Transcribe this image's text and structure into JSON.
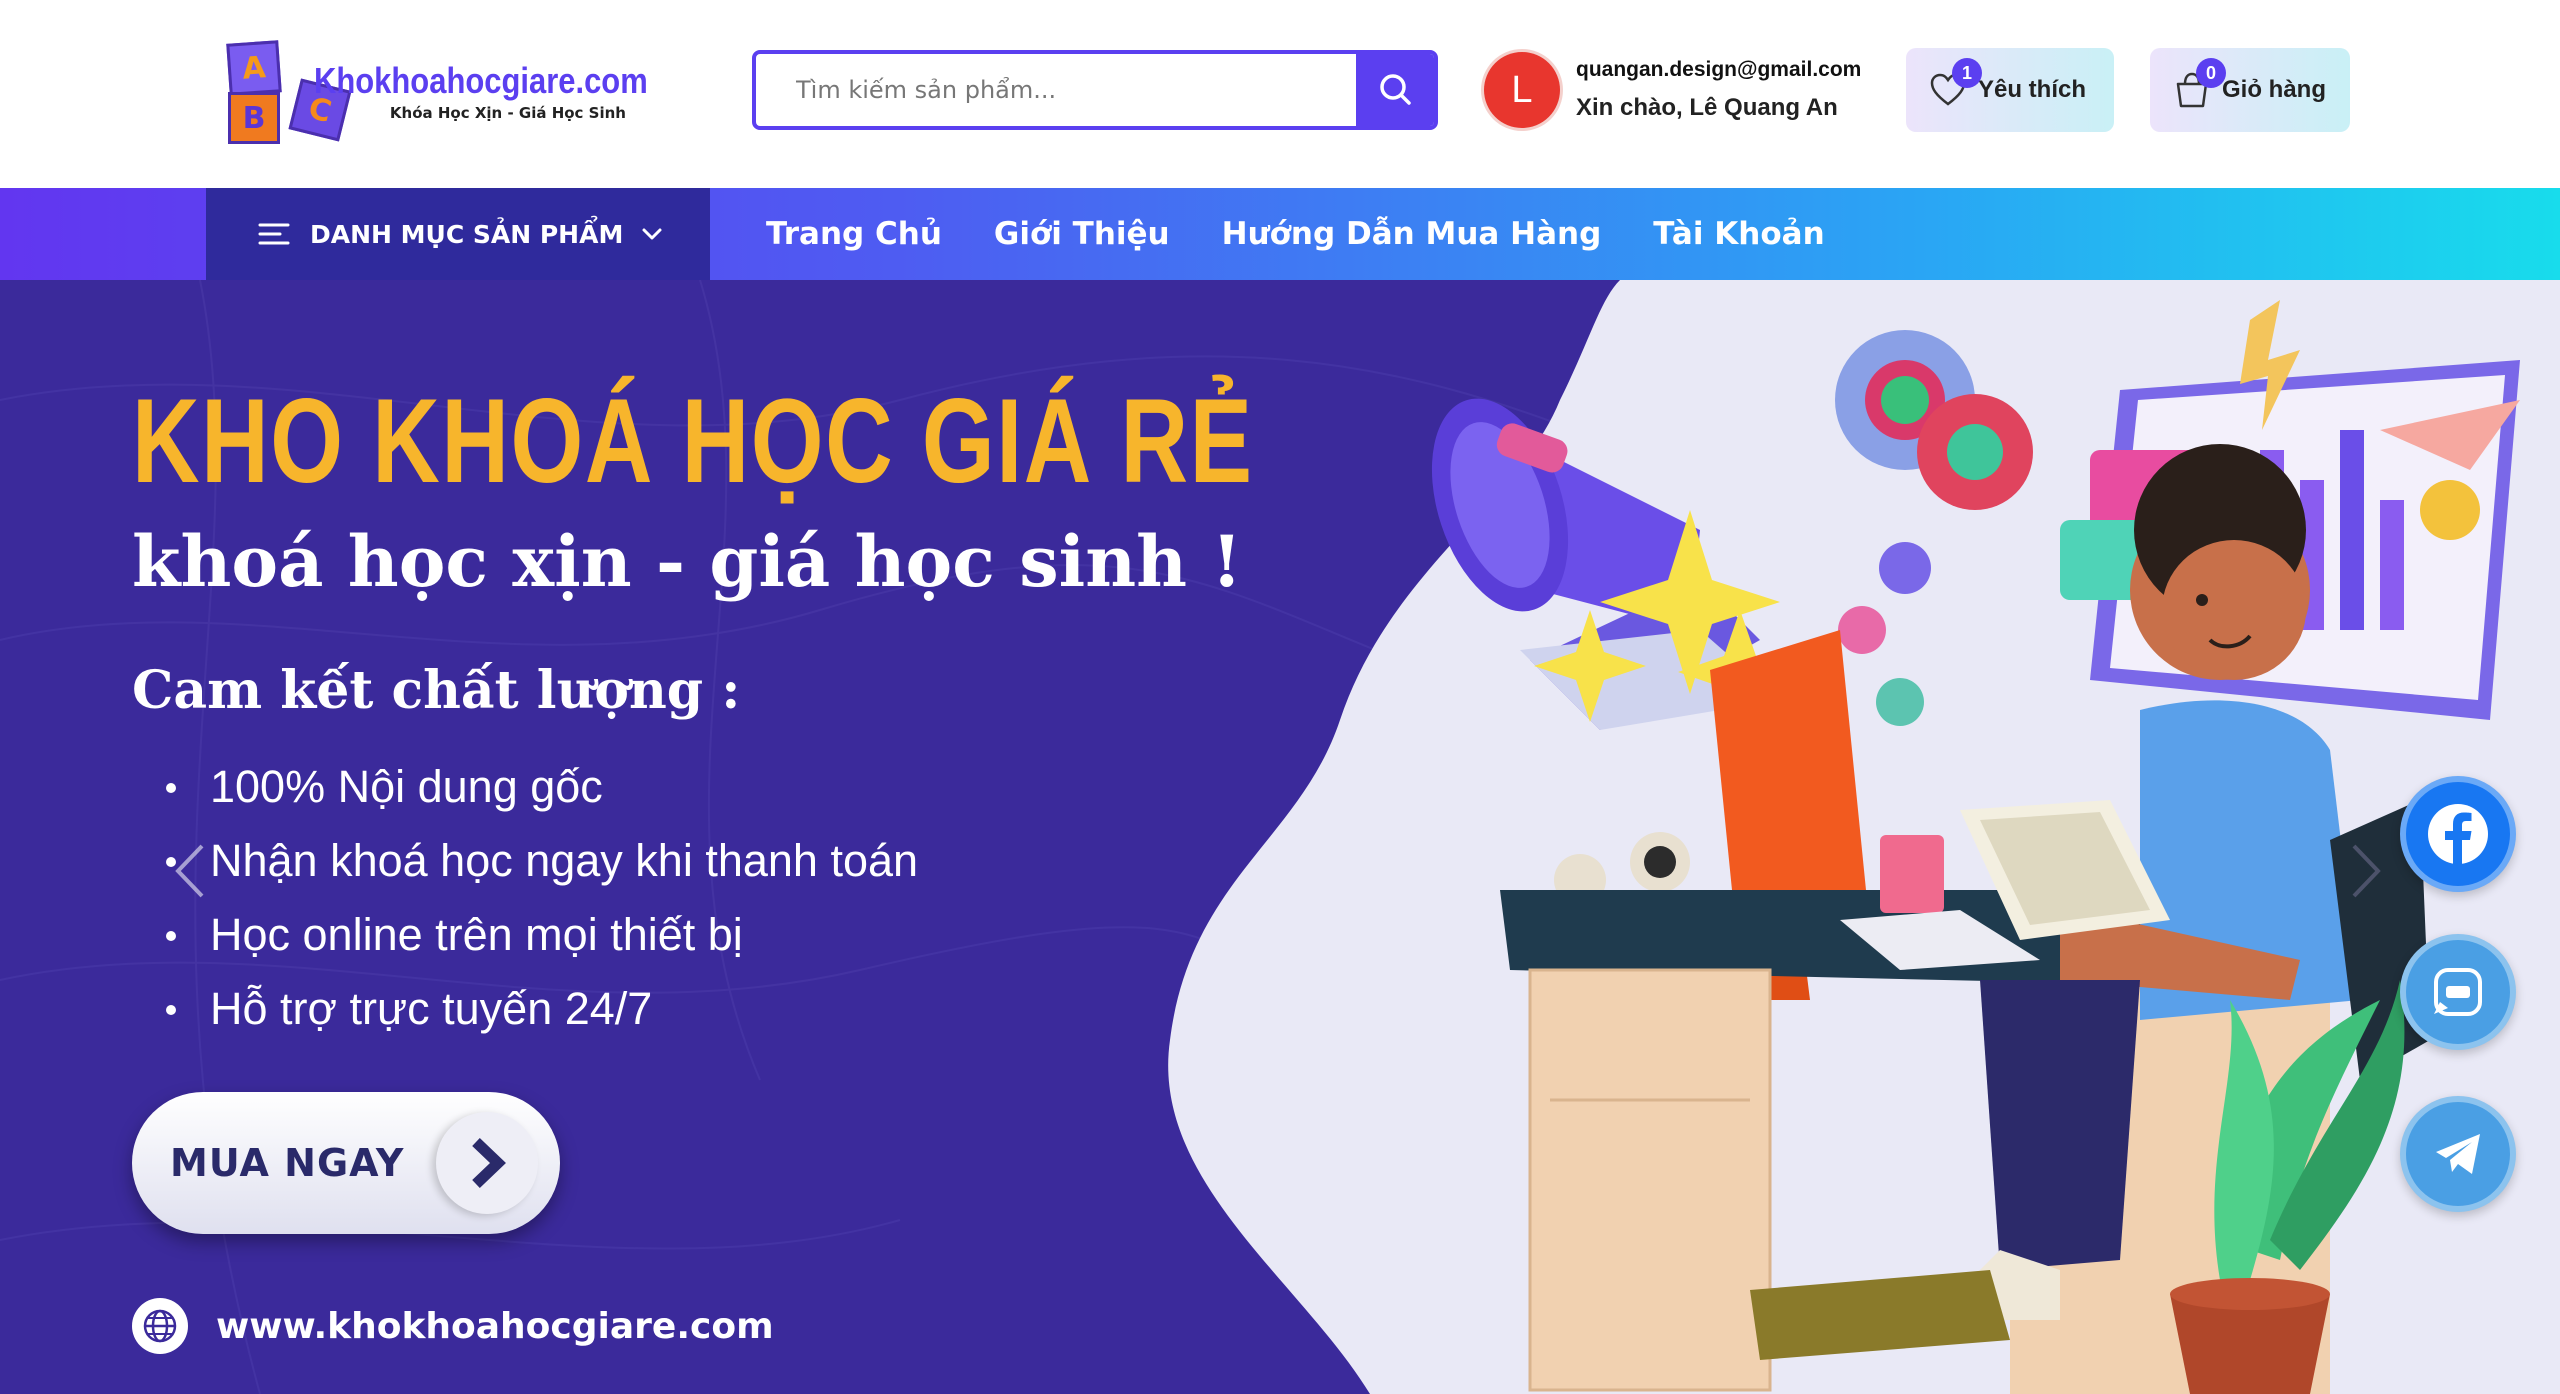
{
  "logo": {
    "letters": [
      "A",
      "B",
      "C"
    ],
    "name": "Khokhoahocgiare.com",
    "tagline": "Khóa Học Xịn - Giá Học Sinh"
  },
  "search": {
    "placeholder": "Tìm kiếm sản phẩm...",
    "value": "",
    "icon": "search-icon"
  },
  "user": {
    "avatar_letter": "L",
    "email": "quangan.design@gmail.com",
    "greeting": "Xin chào, Lê Quang An"
  },
  "wishlist": {
    "count": "1",
    "label": "Yêu thích",
    "icon": "heart-icon"
  },
  "cart": {
    "count": "0",
    "label": "Giỏ hàng",
    "icon": "shopping-bag-icon"
  },
  "nav": {
    "category_label": "DANH MỤC SẢN PHẨM",
    "links": [
      "Trang Chủ",
      "Giới Thiệu",
      "Hướng Dẫn Mua Hàng",
      "Tài Khoản"
    ]
  },
  "hero": {
    "title": "KHO KHOÁ HỌC GIÁ RẺ",
    "subtitle": "khoá học xịn - giá học sinh !",
    "commitment": "Cam kết chất lượng :",
    "bullets": [
      "100% Nội dung gốc",
      "Nhận khoá học ngay khi thanh toán",
      "Học online trên mọi thiết bị",
      "Hỗ trợ trực tuyến 24/7"
    ],
    "cta": "MUA NGAY",
    "website": "www.khokhoahocgiare.com"
  },
  "social": [
    "facebook-icon",
    "zalo-icon",
    "telegram-icon"
  ],
  "colors": {
    "brand": "#5b3ff0",
    "hero_bg": "#3b2a9b",
    "title_yellow": "#f7b52c",
    "avatar_red": "#e8362e",
    "facebook": "#1877f2"
  }
}
